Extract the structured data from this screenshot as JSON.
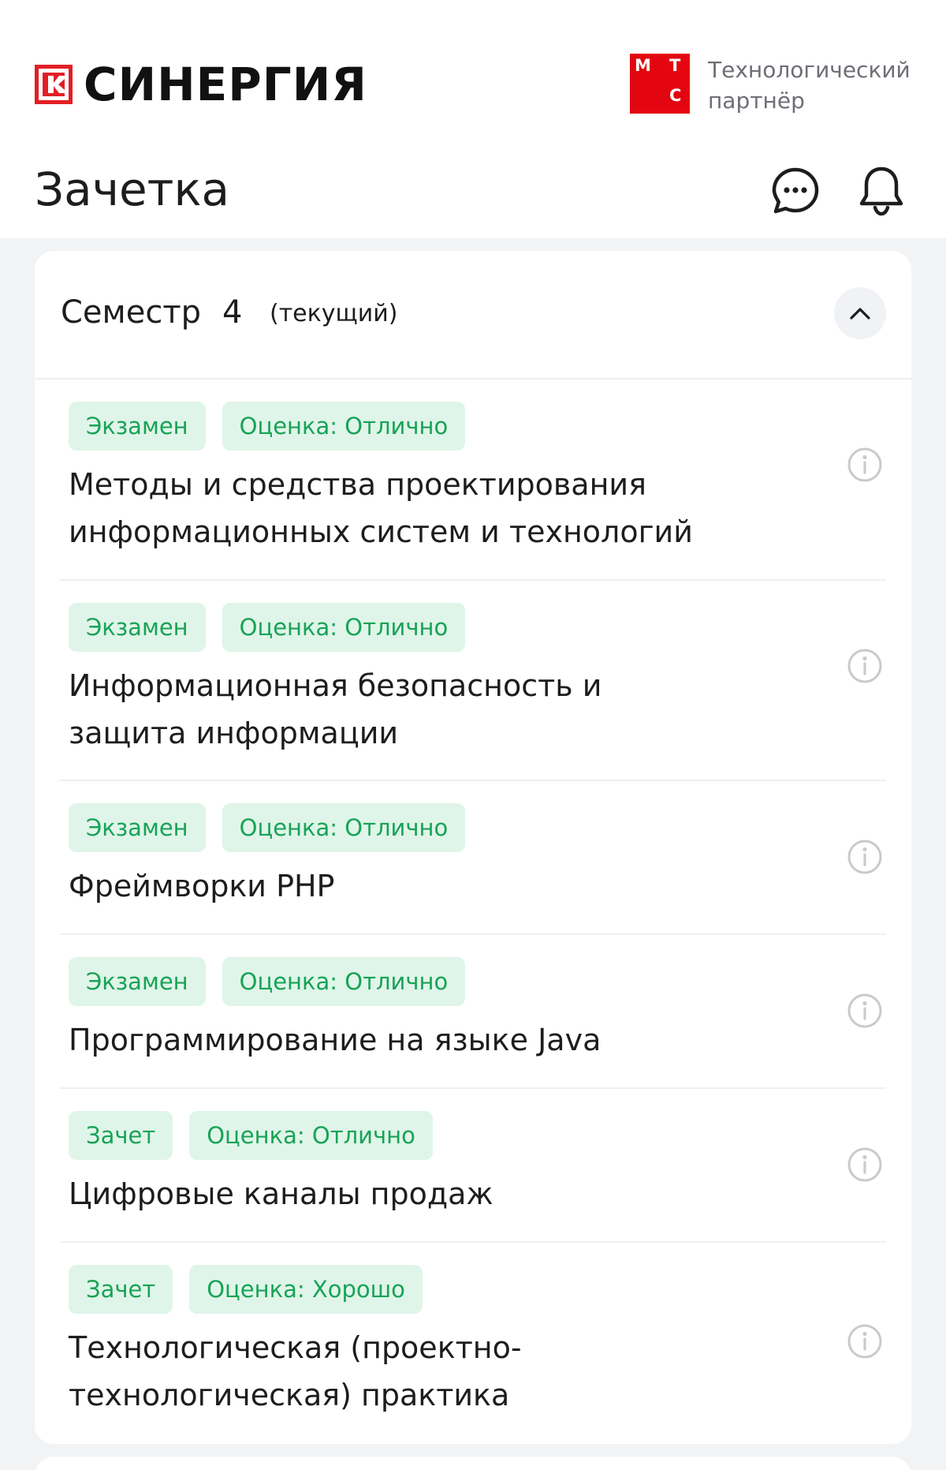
{
  "header": {
    "brand": "СИНЕРГИЯ",
    "partner": {
      "badge": {
        "m": "М",
        "t": "Т",
        "s": "С"
      },
      "line1": "Технологический",
      "line2": "партнёр"
    },
    "title": "Зачетка",
    "icons": {
      "chat": "chat-icon",
      "notifications": "bell-icon"
    }
  },
  "semester": {
    "label": "Семестр",
    "number": "4",
    "status": "(текущий)",
    "toggle_icon": "chevron-up-icon"
  },
  "courses": [
    {
      "type": "Экзамен",
      "grade": "Оценка: Отлично",
      "name": "Методы и средства проектирования информационных систем и технологий"
    },
    {
      "type": "Экзамен",
      "grade": "Оценка: Отлично",
      "name": "Информационная безопасность и защита информации"
    },
    {
      "type": "Экзамен",
      "grade": "Оценка: Отлично",
      "name": "Фреймворки PHP"
    },
    {
      "type": "Экзамен",
      "grade": "Оценка: Отлично",
      "name": "Программирование на языке Java"
    },
    {
      "type": "Зачет",
      "grade": "Оценка: Отлично",
      "name": "Цифровые каналы продаж"
    },
    {
      "type": "Зачет",
      "grade": "Оценка: Хорошо",
      "name": "Технологическая (проектно-технологическая) практика"
    }
  ],
  "colors": {
    "brand_red": "#e31e24",
    "mts_red": "#e30611",
    "tag_bg": "#e0f5e9",
    "tag_text": "#17a356",
    "page_bg": "#f2f3f5"
  }
}
